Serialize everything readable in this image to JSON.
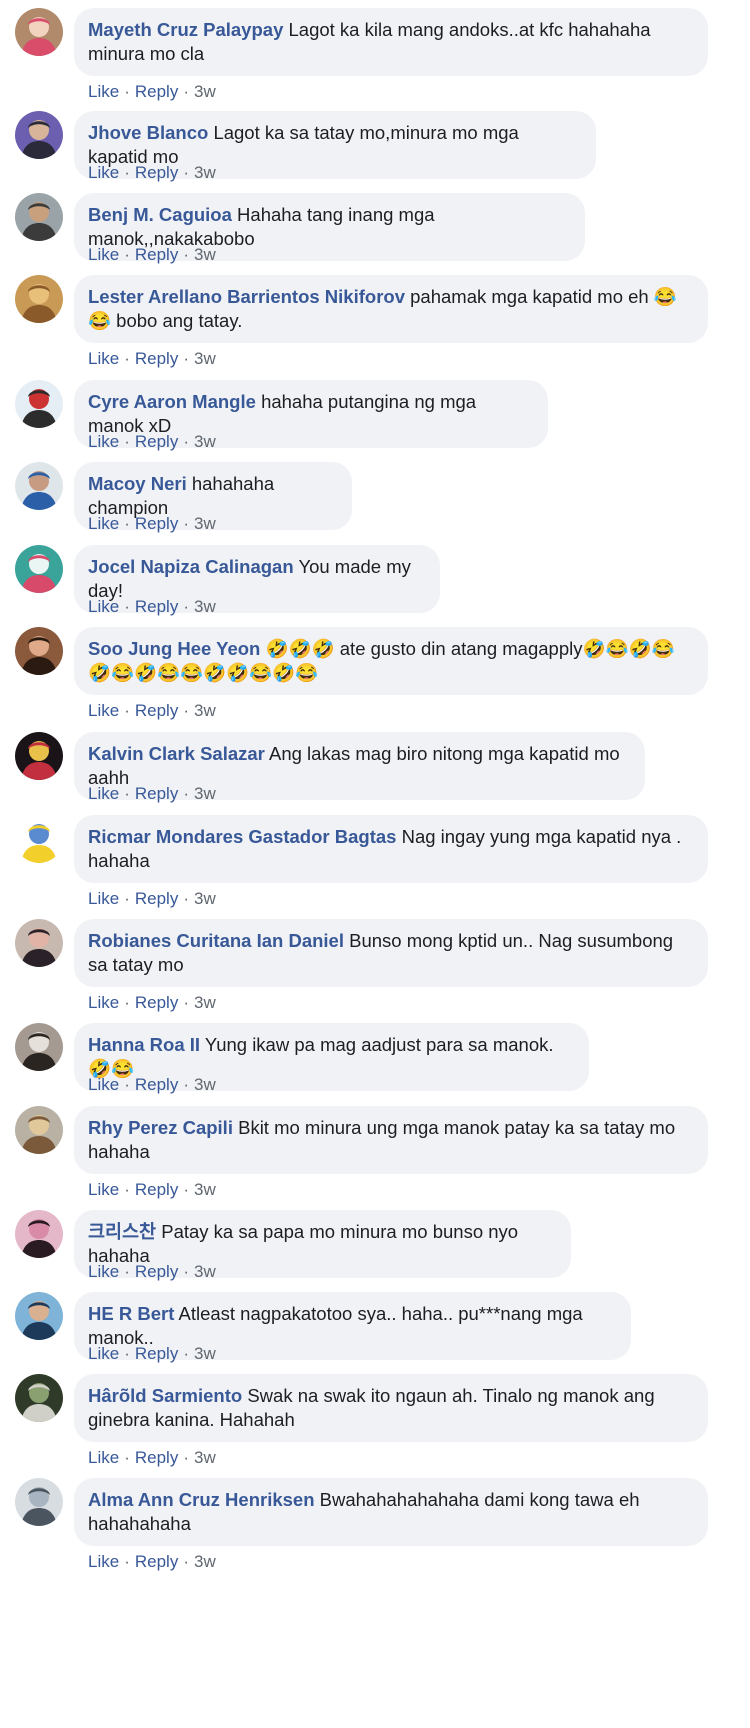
{
  "comments": [
    {
      "author": "Mayeth Cruz Palaypay",
      "text": "Lagot ka kila mang andoks..at kfc hahahaha minura mo cla",
      "like": "Like",
      "reply": "Reply",
      "time": "3w",
      "avatar": {
        "bg": "#b08a6a",
        "fg": "#d94c6a",
        "accent": "#f2d3c0"
      }
    },
    {
      "author": "Jhove Blanco",
      "text": "Lagot ka sa tatay mo,minura mo mga kapatid mo",
      "like": "Like",
      "reply": "Reply",
      "time": "3w",
      "avatar": {
        "bg": "#6d5fb0",
        "fg": "#2a2a3a",
        "accent": "#d7b49a"
      }
    },
    {
      "author": "Benj M. Caguioa",
      "text": "Hahaha tang inang mga manok,,nakakabobo",
      "like": "Like",
      "reply": "Reply",
      "time": "3w",
      "avatar": {
        "bg": "#9aa3a8",
        "fg": "#3b3b3b",
        "accent": "#c9a07e"
      }
    },
    {
      "author": "Lester Arellano Barrientos Nikiforov",
      "text": "pahamak mga kapatid mo eh 😂😂 bobo ang tatay.",
      "like": "Like",
      "reply": "Reply",
      "time": "3w",
      "avatar": {
        "bg": "#c99a55",
        "fg": "#8a5a2a",
        "accent": "#e8c07a"
      }
    },
    {
      "author": "Cyre Aaron Mangle",
      "text": "hahaha putangina ng mga manok xD",
      "like": "Like",
      "reply": "Reply",
      "time": "3w",
      "avatar": {
        "bg": "#e6eef5",
        "fg": "#2c2c2c",
        "accent": "#c33"
      }
    },
    {
      "author": "Macoy Neri",
      "text": "hahahaha champion",
      "like": "Like",
      "reply": "Reply",
      "time": "3w",
      "avatar": {
        "bg": "#dfe6ea",
        "fg": "#2b5fa8",
        "accent": "#c79b82"
      }
    },
    {
      "author": "Jocel Napiza Calinagan",
      "text": "You made my day!",
      "like": "Like",
      "reply": "Reply",
      "time": "3w",
      "avatar": {
        "bg": "#3aa39a",
        "fg": "#d74a6a",
        "accent": "#eaf6f3"
      }
    },
    {
      "author": "Soo Jung Hee Yeon",
      "text": "🤣🤣🤣 ate gusto din atang magapply🤣😂🤣😂🤣😂🤣😂😂🤣🤣😂🤣😂",
      "like": "Like",
      "reply": "Reply",
      "time": "3w",
      "avatar": {
        "bg": "#8b5a3c",
        "fg": "#2a1a12",
        "accent": "#e0a98a"
      }
    },
    {
      "author": "Kalvin Clark Salazar",
      "text": "Ang lakas mag biro nitong mga kapatid mo aahh",
      "like": "Like",
      "reply": "Reply",
      "time": "3w",
      "avatar": {
        "bg": "#1a1418",
        "fg": "#c23040",
        "accent": "#e8c04a"
      }
    },
    {
      "author": "Ricmar Mondares Gastador Bagtas",
      "text": "Nag ingay yung mga kapatid nya . hahaha",
      "like": "Like",
      "reply": "Reply",
      "time": "3w",
      "avatar": {
        "bg": "#ffffff",
        "fg": "#f2cf2a",
        "accent": "#5a8ad0"
      }
    },
    {
      "author": "Robianes Curitana Ian Daniel",
      "text": "Bunso mong kptid un.. Nag susumbong sa tatay mo",
      "like": "Like",
      "reply": "Reply",
      "time": "3w",
      "avatar": {
        "bg": "#c7b9b0",
        "fg": "#2a2228",
        "accent": "#e0b3a6"
      }
    },
    {
      "author": "Hanna Roa II",
      "text": "Yung ikaw pa mag aadjust para sa manok. 🤣😂",
      "like": "Like",
      "reply": "Reply",
      "time": "3w",
      "avatar": {
        "bg": "#a49a92",
        "fg": "#2b2522",
        "accent": "#e6e0da"
      }
    },
    {
      "author": "Rhy Perez Capili",
      "text": "Bkit mo minura ung mga manok patay ka sa tatay mo hahaha",
      "like": "Like",
      "reply": "Reply",
      "time": "3w",
      "avatar": {
        "bg": "#b9b2a4",
        "fg": "#7a5a3a",
        "accent": "#e0c89a"
      }
    },
    {
      "author": "크리스찬",
      "text": "Patay ka sa papa mo minura mo bunso nyo hahaha",
      "like": "Like",
      "reply": "Reply",
      "time": "3w",
      "avatar": {
        "bg": "#e4b8c8",
        "fg": "#2a1a22",
        "accent": "#d98aa6"
      }
    },
    {
      "author": "HE R Bert",
      "text": "Atleast nagpakatotoo sya.. haha.. pu***nang mga manok..",
      "like": "Like",
      "reply": "Reply",
      "time": "3w",
      "avatar": {
        "bg": "#7fb4d8",
        "fg": "#1e3a5a",
        "accent": "#d9b090"
      }
    },
    {
      "author": "Hârõld Sarmiento",
      "text": "Swak na swak ito ngaun ah. Tinalo ng manok ang ginebra kanina. Hahahah",
      "like": "Like",
      "reply": "Reply",
      "time": "3w",
      "avatar": {
        "bg": "#2f3a28",
        "fg": "#d0d0c8",
        "accent": "#8aa070"
      }
    },
    {
      "author": "Alma Ann Cruz Henriksen",
      "text": "Bwahahahahahaha dami kong tawa eh hahahahaha",
      "like": "Like",
      "reply": "Reply",
      "time": "3w",
      "avatar": {
        "bg": "#d8dde2",
        "fg": "#4a5560",
        "accent": "#a8b4bf"
      }
    }
  ]
}
